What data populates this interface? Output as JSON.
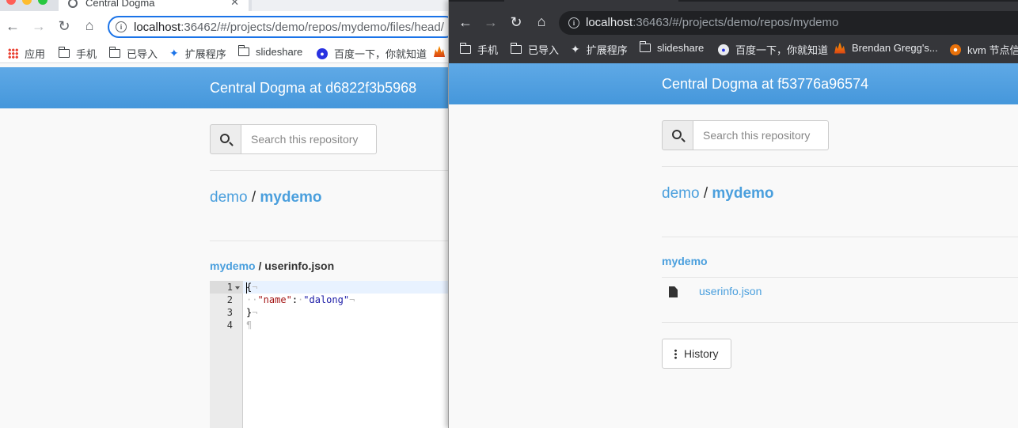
{
  "left_window": {
    "tab_title": "Central Dogma",
    "tab_close_icon": "close-icon",
    "address": {
      "host": "localhost",
      "rest": ":36462/#/projects/demo/repos/mydemo/files/head/"
    },
    "bookmarks": [
      {
        "label": "应用",
        "icon": "apps-icon"
      },
      {
        "label": "手机",
        "icon": "folder-icon"
      },
      {
        "label": "已导入",
        "icon": "folder-icon"
      },
      {
        "label": "扩展程序",
        "icon": "puzzle-icon"
      },
      {
        "label": "slideshare",
        "icon": "folder-icon"
      },
      {
        "label": "百度一下，你就知道",
        "icon": "paw-icon"
      }
    ],
    "header_title": "Central Dogma at d6822f3b5968",
    "search_placeholder": "Search this repository",
    "breadcrumb": {
      "project": "demo",
      "separator": "/",
      "repo": "mydemo"
    },
    "file_breadcrumb": {
      "repo": "mydemo",
      "separator": "/",
      "file": "userinfo.json"
    },
    "editor": {
      "line_numbers": [
        "1",
        "2",
        "3",
        "4"
      ],
      "lines": [
        {
          "text": "{",
          "trail": "¬"
        },
        {
          "indent": "··",
          "key": "\"name\"",
          "colon": ":",
          "space": "·",
          "value": "\"dalong\"",
          "trail": "¬"
        },
        {
          "text": "}",
          "trail": "¬"
        },
        {
          "text": "",
          "trail": "¶"
        }
      ]
    }
  },
  "right_window": {
    "address": {
      "host": "localhost",
      "rest": ":36463/#/projects/demo/repos/mydemo"
    },
    "bookmarks": [
      {
        "label": "手机",
        "icon": "folder-icon"
      },
      {
        "label": "已导入",
        "icon": "folder-icon"
      },
      {
        "label": "扩展程序",
        "icon": "puzzle-icon"
      },
      {
        "label": "slideshare",
        "icon": "folder-icon"
      },
      {
        "label": "百度一下，你就知道",
        "icon": "paw-icon"
      },
      {
        "label": "Brendan Gregg's...",
        "icon": "flame-icon"
      },
      {
        "label": "kvm 节点信",
        "icon": "gear-icon"
      }
    ],
    "header_title": "Central Dogma at f53776a96574",
    "search_placeholder": "Search this repository",
    "breadcrumb": {
      "project": "demo",
      "separator": "/",
      "repo": "mydemo"
    },
    "repo_heading": "mydemo",
    "files": [
      {
        "name": "userinfo.json",
        "icon": "file-icon"
      }
    ],
    "history_button": "History"
  },
  "colors": {
    "header_blue": "#4a9fdd",
    "link_blue": "#4a9fdd",
    "dark_chrome": "#35363a"
  }
}
